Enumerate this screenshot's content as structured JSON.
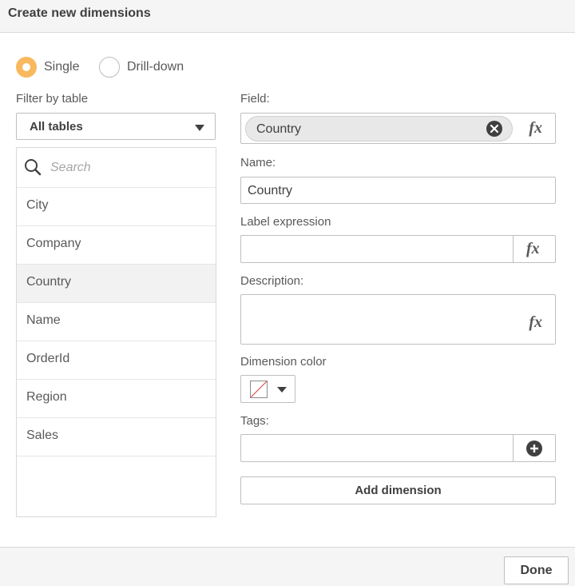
{
  "dialog": {
    "title": "Create new dimensions"
  },
  "mode": {
    "options": [
      {
        "label": "Single",
        "selected": true
      },
      {
        "label": "Drill-down",
        "selected": false
      }
    ]
  },
  "filter": {
    "label": "Filter by table",
    "value": "All tables"
  },
  "search": {
    "placeholder": "Search"
  },
  "fields": [
    "City",
    "Company",
    "Country",
    "Name",
    "OrderId",
    "Region",
    "Sales"
  ],
  "selected_field": "Country",
  "form": {
    "field_label": "Field:",
    "field_value": "Country",
    "name_label": "Name:",
    "name_value": "Country",
    "label_expression_label": "Label expression",
    "label_expression_value": "",
    "description_label": "Description:",
    "description_value": "",
    "dimension_color_label": "Dimension color",
    "tags_label": "Tags:",
    "tags_value": "",
    "fx": "fx"
  },
  "buttons": {
    "add_dimension": "Add dimension",
    "done": "Done"
  },
  "colors": {
    "accent": "#f8b95e",
    "header_bg": "#f5f5f5",
    "chip_bg": "#e8e8e8"
  }
}
